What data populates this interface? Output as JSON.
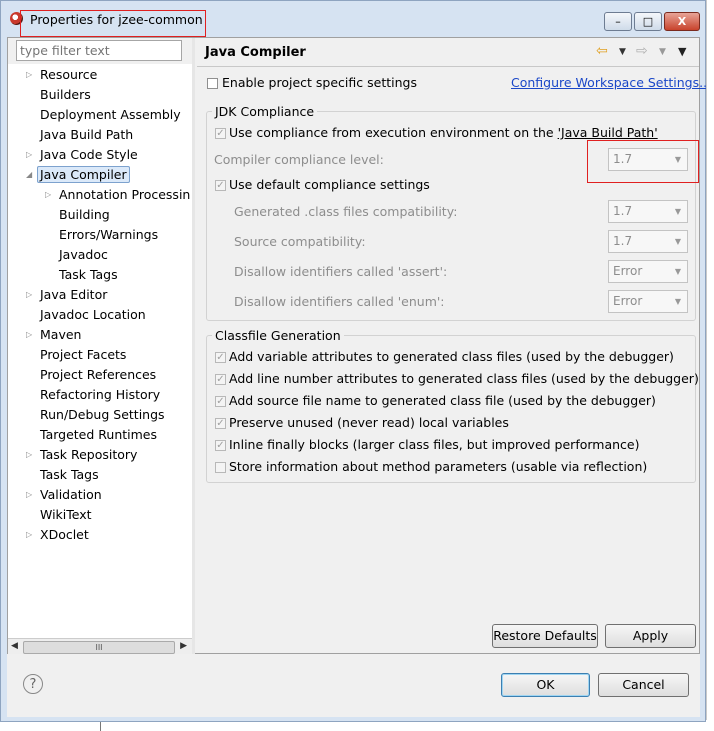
{
  "window": {
    "title": "Properties for jzee-common",
    "min_label": "–",
    "max_label": "□",
    "close_label": "X"
  },
  "sidebar": {
    "filter_placeholder": "type filter text",
    "items": [
      {
        "label": "Resource",
        "level": 0,
        "expandable": true
      },
      {
        "label": "Builders",
        "level": 0,
        "expandable": false
      },
      {
        "label": "Deployment Assembly",
        "level": 0,
        "expandable": false
      },
      {
        "label": "Java Build Path",
        "level": 0,
        "expandable": false
      },
      {
        "label": "Java Code Style",
        "level": 0,
        "expandable": true
      },
      {
        "label": "Java Compiler",
        "level": 0,
        "expandable": true,
        "expanded": true,
        "selected": true
      },
      {
        "label": "Annotation Processin",
        "level": 1,
        "expandable": true
      },
      {
        "label": "Building",
        "level": 1,
        "expandable": false
      },
      {
        "label": "Errors/Warnings",
        "level": 1,
        "expandable": false
      },
      {
        "label": "Javadoc",
        "level": 1,
        "expandable": false
      },
      {
        "label": "Task Tags",
        "level": 1,
        "expandable": false
      },
      {
        "label": "Java Editor",
        "level": 0,
        "expandable": true
      },
      {
        "label": "Javadoc Location",
        "level": 0,
        "expandable": false
      },
      {
        "label": "Maven",
        "level": 0,
        "expandable": true
      },
      {
        "label": "Project Facets",
        "level": 0,
        "expandable": false
      },
      {
        "label": "Project References",
        "level": 0,
        "expandable": false
      },
      {
        "label": "Refactoring History",
        "level": 0,
        "expandable": false
      },
      {
        "label": "Run/Debug Settings",
        "level": 0,
        "expandable": false
      },
      {
        "label": "Targeted Runtimes",
        "level": 0,
        "expandable": false
      },
      {
        "label": "Task Repository",
        "level": 0,
        "expandable": true
      },
      {
        "label": "Task Tags",
        "level": 0,
        "expandable": false
      },
      {
        "label": "Validation",
        "level": 0,
        "expandable": true
      },
      {
        "label": "WikiText",
        "level": 0,
        "expandable": false
      },
      {
        "label": "XDoclet",
        "level": 0,
        "expandable": true
      }
    ],
    "scroll_thumb": "III"
  },
  "page": {
    "title": "Java Compiler",
    "nav_back": "⇦",
    "nav_forward": "⇨",
    "menu": "▼",
    "enable_specific": "Enable project specific settings",
    "configure_link": "Configure Workspace Settings...",
    "jdk_group": "JDK Compliance",
    "use_compliance": "Use compliance from execution environment on the ",
    "use_compliance_path": "'Java Build Path'",
    "compliance_level_label": "Compiler compliance level:",
    "compliance_level_value": "1.7",
    "use_default": "Use default compliance settings",
    "generated_label": "Generated .class files compatibility:",
    "generated_value": "1.7",
    "source_label": "Source compatibility:",
    "source_value": "1.7",
    "assert_label": "Disallow identifiers called 'assert':",
    "assert_value": "Error",
    "enum_label": "Disallow identifiers called 'enum':",
    "enum_value": "Error",
    "classfile_group": "Classfile Generation",
    "opt_variable": "Add variable attributes to generated class files (used by the debugger)",
    "opt_line": "Add line number attributes to generated class files (used by the debugger)",
    "opt_source": "Add source file name to generated class file (used by the debugger)",
    "opt_preserve": "Preserve unused (never read) local variables",
    "opt_inline": "Inline finally blocks (larger class files, but improved performance)",
    "opt_store": "Store information about method parameters (usable via reflection)",
    "restore_defaults": "Restore Defaults",
    "apply": "Apply"
  },
  "footer": {
    "help": "?",
    "ok": "OK",
    "cancel": "Cancel"
  },
  "colors": {
    "highlight_box": "#e02020",
    "link": "#1a47c8",
    "disabled_text": "#8d8d8d"
  }
}
